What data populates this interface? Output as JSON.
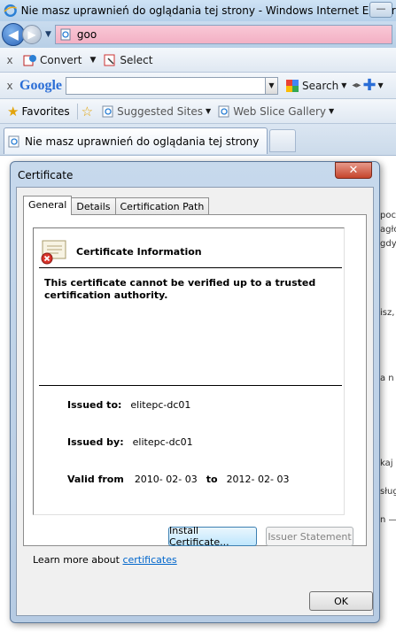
{
  "browser": {
    "title": "Nie masz uprawnień do oglądania tej strony - Windows Internet Explorer",
    "minimize_glyph": "—",
    "address": "goo"
  },
  "toolbar1": {
    "close_glyph": "x",
    "convert_label": "Convert",
    "select_label": "Select"
  },
  "toolbar2": {
    "close_glyph": "x",
    "google_logo": "Google",
    "search_label": "Search"
  },
  "favorites_bar": {
    "favorites_label": "Favorites",
    "suggested_sites_label": "Suggested Sites",
    "web_slice_gallery_label": "Web Slice Gallery"
  },
  "tab": {
    "title": "Nie masz uprawnień do oglądania tej strony"
  },
  "page_fragments": [
    "poc",
    "agło",
    "gdy",
    "isz,",
    "a n",
    "kaj",
    "sług",
    "n —"
  ],
  "dialog": {
    "title": "Certificate",
    "close_glyph": "✕",
    "tabs": [
      "General",
      "Details",
      "Certification Path"
    ],
    "info_title": "Certificate Information",
    "warning": "This certificate cannot be verified up to a trusted certification authority.",
    "issued_to_label": "Issued to:",
    "issued_to_value": "elitepc-dc01",
    "issued_by_label": "Issued by:",
    "issued_by_value": "elitepc-dc01",
    "valid_from_label": "Valid from",
    "valid_from_value": "2010- 02- 03",
    "valid_to_label": "to",
    "valid_to_value": "2012- 02- 03",
    "install_button": "Install Certificate...",
    "issuer_button": "Issuer Statement",
    "learn_prefix": "Learn more about ",
    "learn_link": "certificates",
    "ok_button": "OK"
  },
  "colors": {
    "address_bar_bg": "#f3b0c4",
    "link": "#0066cc",
    "close_button": "#c5452c"
  }
}
